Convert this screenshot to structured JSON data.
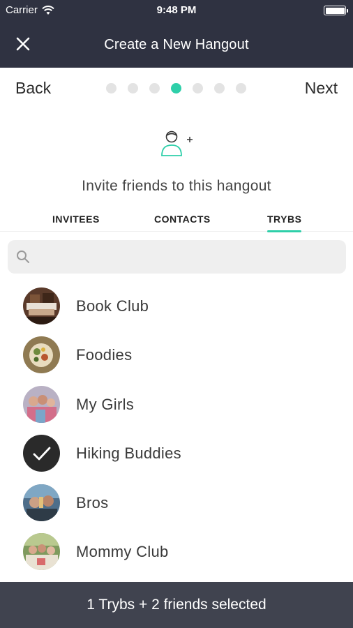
{
  "status": {
    "carrier": "Carrier",
    "time": "9:48 PM"
  },
  "nav": {
    "title": "Create a New Hangout",
    "close_icon": "close-icon"
  },
  "stepper": {
    "back_label": "Back",
    "next_label": "Next",
    "total_steps": 7,
    "current_step": 4
  },
  "invite": {
    "icon": "add-person-icon",
    "text": "Invite friends to this hangout"
  },
  "tabs": [
    {
      "label": "INVITEES",
      "active": false
    },
    {
      "label": "CONTACTS",
      "active": false
    },
    {
      "label": "TRYBS",
      "active": true
    }
  ],
  "search": {
    "placeholder": "",
    "value": ""
  },
  "trybs": [
    {
      "name": "Book Club",
      "selected": false
    },
    {
      "name": "Foodies",
      "selected": false
    },
    {
      "name": "My Girls",
      "selected": false
    },
    {
      "name": "Hiking Buddies",
      "selected": true
    },
    {
      "name": "Bros",
      "selected": false
    },
    {
      "name": "Mommy Club",
      "selected": false
    }
  ],
  "footer": {
    "summary": "1 Trybs + 2 friends selected"
  },
  "colors": {
    "header_bg": "#2f3241",
    "accent": "#2ecfa9",
    "footer_bg": "#40434f",
    "selected_avatar": "#2a2a2a"
  }
}
